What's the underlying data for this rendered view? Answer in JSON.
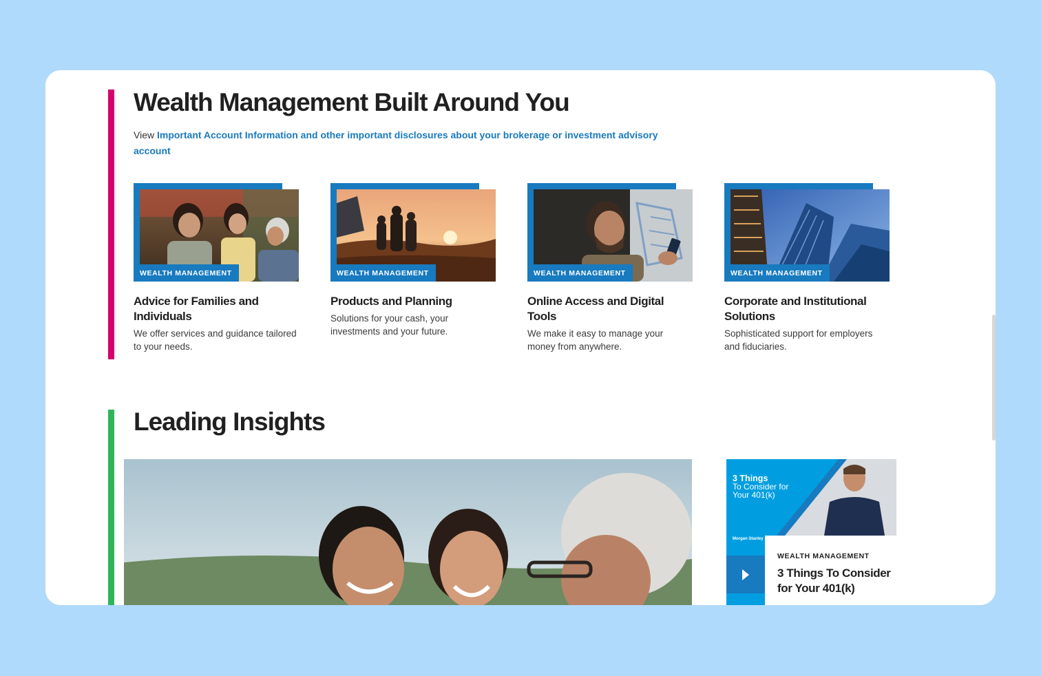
{
  "section1": {
    "title": "Wealth Management Built Around You",
    "disclosure_prefix": "View ",
    "disclosure_link": "Important Account Information and other important disclosures about your brokerage or investment advisory account",
    "accent_color": "#d5006d"
  },
  "cards": [
    {
      "tag": "WEALTH MANAGEMENT",
      "title": "Advice for Families and Individuals",
      "desc": "We offer services and guidance tailored to your needs.",
      "image": "family-photo"
    },
    {
      "tag": "WEALTH MANAGEMENT",
      "title": "Products and Planning",
      "desc": "Solutions for your cash, your investments and your future.",
      "image": "sunset-family-photo"
    },
    {
      "tag": "WEALTH MANAGEMENT",
      "title": "Online Access and Digital Tools",
      "desc": "We make it easy to manage your money from anywhere.",
      "image": "man-with-phone-photo"
    },
    {
      "tag": "WEALTH MANAGEMENT",
      "title": "Corporate and Institutional Solutions",
      "desc": "Sophisticated support for employers and fiduciaries.",
      "image": "skyscrapers-photo"
    }
  ],
  "section2": {
    "title": "Leading Insights",
    "accent_color": "#2fb45a",
    "hero_image": "family-generations-photo"
  },
  "video": {
    "thumb_title": "3 Things",
    "thumb_subtitle_1": "To Consider for",
    "thumb_subtitle_2": "Your 401(k)",
    "brand": "Morgan Stanley",
    "tag": "WEALTH MANAGEMENT",
    "title": "3 Things To Consider for Your 401(k)",
    "play_icon": "play-icon"
  },
  "colors": {
    "brand_blue": "#187abf",
    "background": "#afdafb"
  }
}
